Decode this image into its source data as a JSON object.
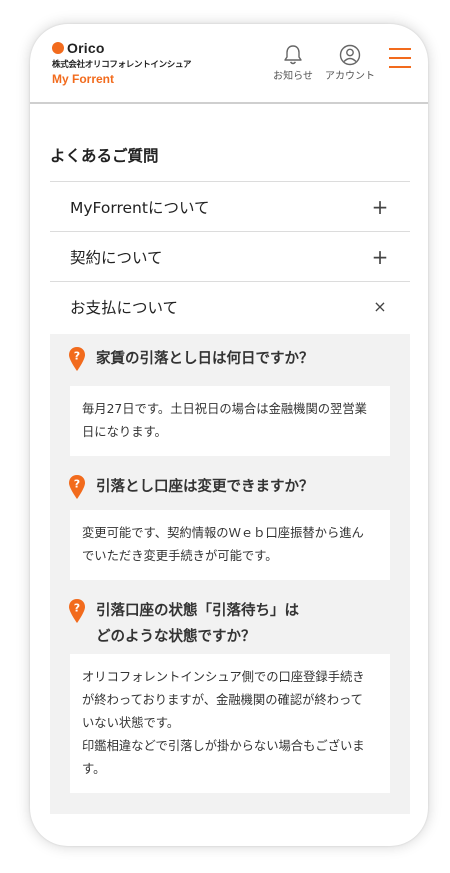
{
  "header": {
    "brand_name": "Orico",
    "company_name": "株式会社オリコフォレントインシュア",
    "product_name": "My Forrent",
    "notice_label": "お知らせ",
    "account_label": "アカウント"
  },
  "colors": {
    "accent": "#f26b1d",
    "panel_bg": "#f2f2f2"
  },
  "icons": {
    "notice": "bell-icon",
    "account": "user-icon",
    "menu": "hamburger-menu-icon",
    "question": "question-pin-icon"
  },
  "faq": {
    "title": "よくあるご質問",
    "categories": [
      {
        "label": "MyForrentについて",
        "toggle": "+"
      },
      {
        "label": "契約について",
        "toggle": "+"
      },
      {
        "label": "お支払について",
        "toggle": "×"
      }
    ],
    "items": [
      {
        "question_lines": [
          "家賃の引落とし日は何日ですか？"
        ],
        "answer_lines": [
          "毎月27日です。土日祝日の場合は金融機関の翌営業",
          "日になります。"
        ]
      },
      {
        "question_lines": [
          "引落とし口座は変更できますか？"
        ],
        "answer_lines": [
          "変更可能です、契約情報のＷｅｂ口座振替から進ん",
          "でいただき変更手続きが可能です。"
        ]
      },
      {
        "question_lines": [
          "引落口座の状態「引落待ち」は",
          "どのような状態ですか？"
        ],
        "answer_lines": [
          "オリコフォレントインシュア側での口座登録手続き",
          "が終わっておりますが、金融機関の確認が終わって",
          "いない状態です。",
          "印鑑相違などで引落しが掛からない場合もございま",
          "す。"
        ]
      }
    ]
  }
}
